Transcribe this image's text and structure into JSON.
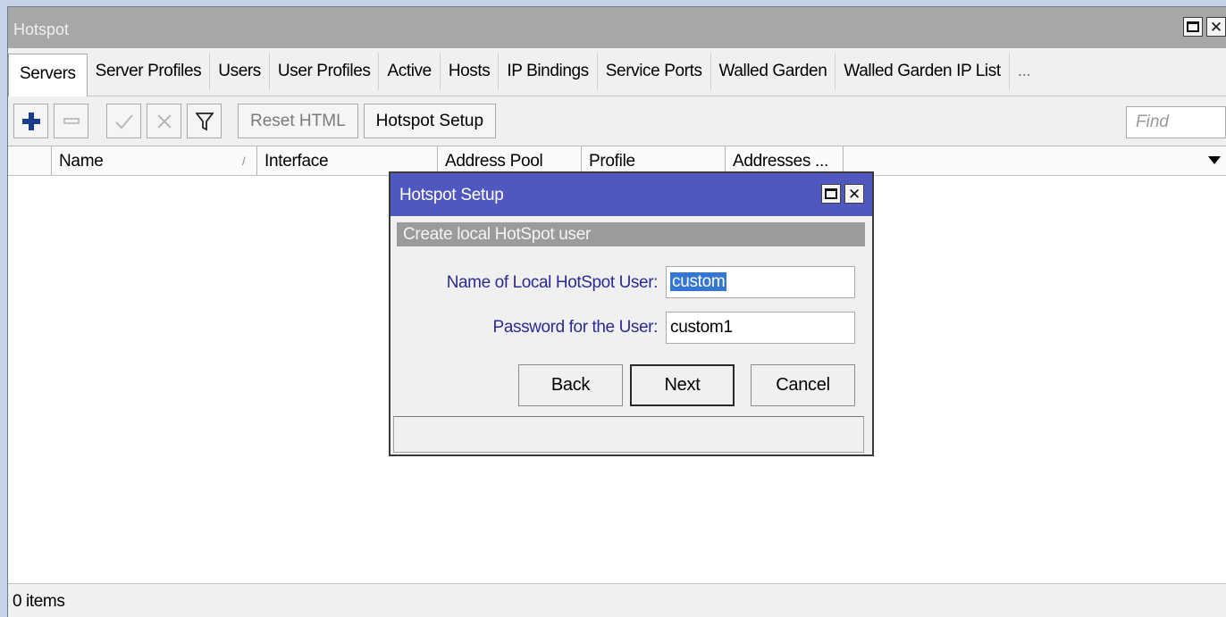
{
  "window": {
    "title": "Hotspot"
  },
  "tabs": [
    {
      "label": "Servers"
    },
    {
      "label": "Server Profiles"
    },
    {
      "label": "Users"
    },
    {
      "label": "User Profiles"
    },
    {
      "label": "Active"
    },
    {
      "label": "Hosts"
    },
    {
      "label": "IP Bindings"
    },
    {
      "label": "Service Ports"
    },
    {
      "label": "Walled Garden"
    },
    {
      "label": "Walled Garden IP List"
    },
    {
      "label": "..."
    }
  ],
  "toolbar": {
    "reset_html": "Reset HTML",
    "hotspot_setup": "Hotspot Setup",
    "find_placeholder": "Find"
  },
  "columns": {
    "name": "Name",
    "interface": "Interface",
    "address_pool": "Address Pool",
    "profile": "Profile",
    "addresses": "Addresses ..."
  },
  "status": {
    "items": "0 items"
  },
  "dialog": {
    "title": "Hotspot Setup",
    "subtitle": "Create local HotSpot user",
    "name_label": "Name of Local HotSpot User:",
    "name_value": "custom",
    "password_label": "Password for the User:",
    "password_value": "custom1",
    "back": "Back",
    "next": "Next",
    "cancel": "Cancel"
  },
  "colors": {
    "dialog_title_bg": "#5058c0",
    "label_blue": "#2b2b95",
    "selection": "#3476d2",
    "add_icon": "#1a3c8a"
  }
}
